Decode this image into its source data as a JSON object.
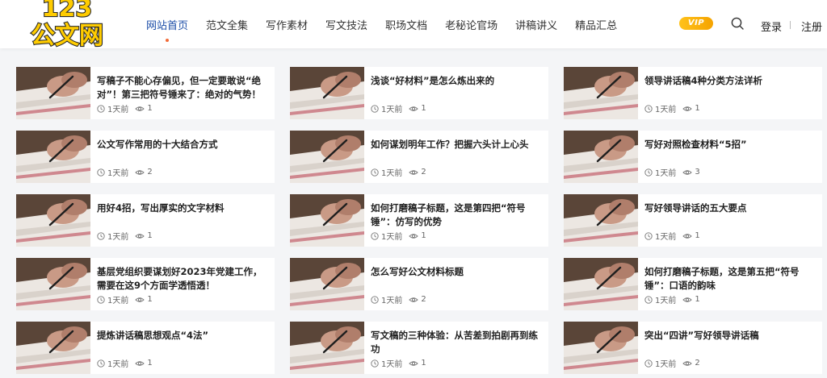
{
  "logo": {
    "text_top": "123",
    "text_bottom": "公文网"
  },
  "nav": [
    {
      "label": "网站首页",
      "active": true
    },
    {
      "label": "范文全集",
      "active": false
    },
    {
      "label": "写作素材",
      "active": false
    },
    {
      "label": "写文技法",
      "active": false
    },
    {
      "label": "职场文档",
      "active": false
    },
    {
      "label": "老秘论官场",
      "active": false
    },
    {
      "label": "讲稿讲义",
      "active": false
    },
    {
      "label": "精品汇总",
      "active": false
    }
  ],
  "header": {
    "vip_label": "VIP",
    "login_label": "登录",
    "register_label": "注册"
  },
  "articles": [
    {
      "title": "写稿子不能心存偏见，但一定要敢说“绝对”！第三把符号锤来了：绝对的气势！",
      "time": "1天前",
      "views": "1"
    },
    {
      "title": "浅谈“好材料”是怎么炼出来的",
      "time": "1天前",
      "views": "1"
    },
    {
      "title": "领导讲话稿4种分类方法详析",
      "time": "1天前",
      "views": "1"
    },
    {
      "title": "公文写作常用的十大结合方式",
      "time": "1天前",
      "views": "2"
    },
    {
      "title": "如何谋划明年工作？把握六头计上心头",
      "time": "1天前",
      "views": "2"
    },
    {
      "title": "写好对照检查材料“5招”",
      "time": "1天前",
      "views": "3"
    },
    {
      "title": "用好4招，写出厚实的文字材料",
      "time": "1天前",
      "views": "1"
    },
    {
      "title": "如何打磨稿子标题，这是第四把“符号锤”：仿写的优势",
      "time": "1天前",
      "views": "1"
    },
    {
      "title": "写好领导讲话的五大要点",
      "time": "1天前",
      "views": "1"
    },
    {
      "title": "基层党组织要谋划好2023年党建工作，需要在这9个方面学透悟透！",
      "time": "1天前",
      "views": "1"
    },
    {
      "title": "怎么写好公文材料标题",
      "time": "1天前",
      "views": "2"
    },
    {
      "title": "如何打磨稿子标题，这是第五把“符号锤”：口语的韵味",
      "time": "1天前",
      "views": "1"
    },
    {
      "title": "提炼讲话稿思想观点“4法”",
      "time": "1天前",
      "views": "1"
    },
    {
      "title": "写文稿的三种体验：从苦差到拍剧再到练功",
      "time": "1天前",
      "views": "1"
    },
    {
      "title": "突出“四讲”写好领导讲话稿",
      "time": "1天前",
      "views": "2"
    }
  ],
  "colors": {
    "accent_blue": "#1d4ea8",
    "nav_dot": "#f26b38",
    "vip_gold": "#f5a300",
    "logo_yellow": "#ffcc00"
  }
}
